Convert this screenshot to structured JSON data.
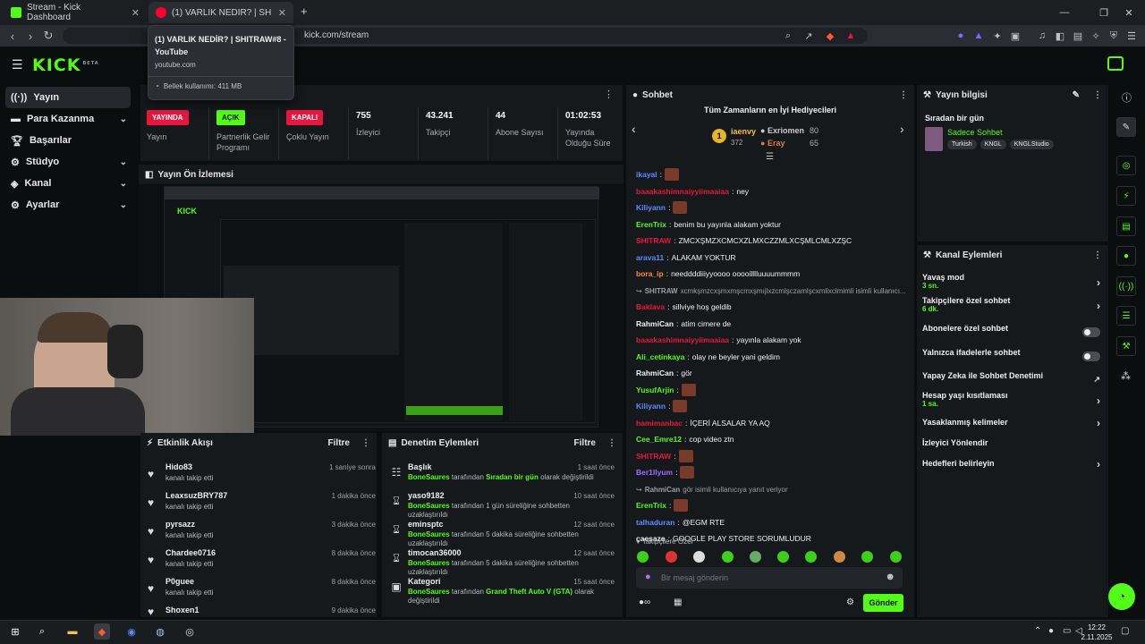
{
  "browser": {
    "tabs": [
      {
        "title": "Stream - Kick Dashboard"
      },
      {
        "title": "(1) VARLIK NEDİR? | SHITRAW#8"
      }
    ],
    "url": "kick.com/stream",
    "tooltip": {
      "title": "(1) VARLIK NEDİR? | SHITRAW#8 - YouTube",
      "domain": "youtube.com",
      "memory": "Bellek kullanımı: 411 MB"
    }
  },
  "logo": {
    "text": "KICK",
    "beta": "BETA"
  },
  "sidebar": {
    "items": [
      {
        "label": "Yayın",
        "icon": "broadcast-icon"
      },
      {
        "label": "Para Kazanma",
        "icon": "money-icon"
      },
      {
        "label": "Başarılar",
        "icon": "trophy-icon"
      },
      {
        "label": "Stüdyo",
        "icon": "studio-icon"
      },
      {
        "label": "Kanal",
        "icon": "channel-icon"
      },
      {
        "label": "Ayarlar",
        "icon": "gear-icon"
      }
    ]
  },
  "stats": [
    {
      "badge": "YAYINDA",
      "label": "Yayın",
      "color": "#e5173f"
    },
    {
      "badge": "AÇIK",
      "label": "Partnerlik Gelir Programı",
      "color": "#53fc18"
    },
    {
      "badge": "KAPALI",
      "label": "Çoklu Yayın",
      "color": "#e5173f"
    },
    {
      "value": "755",
      "label": "İzleyici"
    },
    {
      "value": "43.241",
      "label": "Takipçi"
    },
    {
      "value": "44",
      "label": "Abone Sayısı"
    },
    {
      "value": "01:02:53",
      "label": "Yayında Olduğu Süre"
    }
  ],
  "preview": {
    "title": "Yayın Ön İzlemesi"
  },
  "activity": {
    "title": "Etkinlik Akışı",
    "filter": "Filtre",
    "items": [
      {
        "name": "Hido83",
        "sub": "kanalı takip etti",
        "time": "1 saniye sonra"
      },
      {
        "name": "LeaxsuzBRY787",
        "sub": "kanalı takip etti",
        "time": "1 dakika önce"
      },
      {
        "name": "pyrsazz",
        "sub": "kanalı takip etti",
        "time": "3 dakika önce"
      },
      {
        "name": "Chardee0716",
        "sub": "kanalı takip etti",
        "time": "8 dakika önce"
      },
      {
        "name": "P0guee",
        "sub": "kanalı takip etti",
        "time": "8 dakika önce"
      },
      {
        "name": "Shoxen1",
        "sub": "",
        "time": "9 dakika önce"
      }
    ]
  },
  "moderation": {
    "title": "Denetim Eylemleri",
    "filter": "Filtre",
    "items": [
      {
        "name": "Başlık",
        "actor": "BoneSaures",
        "mid": " tarafından ",
        "obj": "Sıradan bir gün",
        "tail": " olarak değiştirildi",
        "time": "1 saat önce",
        "icon": "document-icon"
      },
      {
        "name": "yaso9182",
        "actor": "BoneSaures",
        "mid": " tarafından 1 gün süreliğine sohbetten uzaklaştırıldı",
        "obj": "",
        "tail": "",
        "time": "10 saat önce",
        "icon": "hourglass-icon"
      },
      {
        "name": "eminsptc",
        "actor": "BoneSaures",
        "mid": " tarafından 5 dakika süreliğine sohbetten uzaklaştırıldı",
        "obj": "",
        "tail": "",
        "time": "12 saat önce",
        "icon": "hourglass-icon"
      },
      {
        "name": "timocan36000",
        "actor": "BoneSaures",
        "mid": " tarafından 5 dakika süreliğine sohbetten uzaklaştırıldı",
        "obj": "",
        "tail": "",
        "time": "12 saat önce",
        "icon": "hourglass-icon"
      },
      {
        "name": "Kategori",
        "actor": "BoneSaures",
        "mid": " tarafından ",
        "obj": "Grand Theft Auto V (GTA)",
        "tail": " olarak değiştirildi",
        "time": "15 saat önce",
        "icon": "category-icon"
      }
    ]
  },
  "chat": {
    "title": "Sohbet",
    "gifters_title": "Tüm Zamanların en İyi Hediyecileri",
    "gifters": [
      {
        "rank": "1",
        "name": "iaenvy",
        "count": "372"
      },
      {
        "name": "Exriomen",
        "count": "80"
      },
      {
        "name": "Eray",
        "count": "65"
      }
    ],
    "messages": [
      {
        "user": "ikayal",
        "color": "#5b8cff",
        "text": "",
        "emote": true
      },
      {
        "user": "baaakashimnaiyyiimaaiaa",
        "color": "#e5173f",
        "text": "ney",
        "emote": false
      },
      {
        "user": "Kiliyann",
        "color": "#5b8cff",
        "text": "",
        "emote": true
      },
      {
        "user": "ErenTrix",
        "color": "#53fc18",
        "text": "benim bu yayınla alakam yoktur",
        "emote": false
      },
      {
        "user": "SHITRAW",
        "color": "#e5173f",
        "text": "ZMCXŞMZXCMCXZLMXCZZMLXCŞMLCMLXZŞC",
        "emote": false
      },
      {
        "user": "arava11",
        "color": "#5b8cff",
        "text": "ALAKAM YOKTUR",
        "emote": false
      },
      {
        "user": "bora_ip",
        "color": "#ff8a3d",
        "text": "needdddiiiyyoooo ooooilllluuuummmm",
        "emote": false
      },
      {
        "user": "SHITRAW",
        "color": "#9ba0a4",
        "text": "xcmkşmzcxşmxmşcmxşmıjlxzcmlşczamlşcxmlixclmimli isimli kullanıcı...",
        "emote": false,
        "reply": true
      },
      {
        "user": "Baklava",
        "color": "#e5173f",
        "text": "sillviye hoş geldib",
        "emote": false
      },
      {
        "user": "RahmiCan",
        "color": "#f0f0f0",
        "text": "atim cimere de",
        "emote": false
      },
      {
        "user": "baaakashimnaiyyiimaaiaa",
        "color": "#e5173f",
        "text": "yayınla alakam yok",
        "emote": false
      },
      {
        "user": "Ali_cetinkaya",
        "color": "#53fc18",
        "text": "olay ne beyler yani geldim",
        "emote": false
      },
      {
        "user": "RahmiCan",
        "color": "#f0f0f0",
        "text": "gör",
        "emote": false
      },
      {
        "user": "YusufArjin",
        "color": "#53fc18",
        "text": "",
        "emote": true
      },
      {
        "user": "Kiliyann",
        "color": "#5b8cff",
        "text": "",
        "emote": true
      },
      {
        "user": "hamimanbac",
        "color": "#e5173f",
        "text": "İÇERİ ALSALAR YA AQ",
        "emote": false
      },
      {
        "user": "Cee_Emre12",
        "color": "#53fc18",
        "text": "cop video ztn",
        "emote": false
      },
      {
        "user": "SHITRAW",
        "color": "#e5173f",
        "text": "",
        "emote": true
      },
      {
        "user": "Ber1llyum",
        "color": "#a66bff",
        "text": "",
        "emote": true
      },
      {
        "user": "RahmiCan",
        "color": "#9ba0a4",
        "text": "gör isimli kullanıcıya yanıt veriyor",
        "emote": false,
        "reply": true
      },
      {
        "user": "ErenTrix",
        "color": "#53fc18",
        "text": "",
        "emote": true
      },
      {
        "user": "talhaduran",
        "color": "#5b8cff",
        "text": "@EGM RTE",
        "emote": false
      },
      {
        "user": "caesaze",
        "color": "#f0f0f0",
        "text": "GOOGLE PLAY STORE SORUMLUDUR",
        "emote": false
      }
    ],
    "followers_only": "Takipçilere Özel",
    "input_placeholder": "Bir mesaj gönderin",
    "send": "Gönder"
  },
  "stream_info": {
    "title": "Yayın bilgisi",
    "stream_title": "Sıradan bir gün",
    "category": "Sadece Sohbet",
    "tags": [
      "Turkish",
      "KNGL",
      "KNGLStudio"
    ]
  },
  "channel_actions": {
    "title": "Kanal Eylemleri",
    "items": [
      {
        "label": "Yavaş mod",
        "sub": "3 sn.",
        "type": "arrow"
      },
      {
        "label": "Takipçilere özel sohbet",
        "sub": "6 dk.",
        "type": "arrow"
      },
      {
        "label": "Abonelere özel sohbet",
        "sub": "",
        "type": "toggle"
      },
      {
        "label": "Yalnızca ifadelerle sohbet",
        "sub": "",
        "type": "toggle"
      },
      {
        "label": "Yapay Zeka ile Sohbet Denetimi",
        "sub": "",
        "type": "external"
      },
      {
        "label": "Hesap yaşı kısıtlaması",
        "sub": "1 sa.",
        "type": "arrow"
      },
      {
        "label": "Yasaklanmış kelimeler",
        "sub": "",
        "type": "arrow"
      },
      {
        "label": "İzleyici Yönlendir",
        "sub": "",
        "type": "none"
      },
      {
        "label": "Hedefleri belirleyin",
        "sub": "",
        "type": "arrow"
      }
    ]
  },
  "taskbar": {
    "time": "12:22",
    "date": "2.11.2025"
  }
}
